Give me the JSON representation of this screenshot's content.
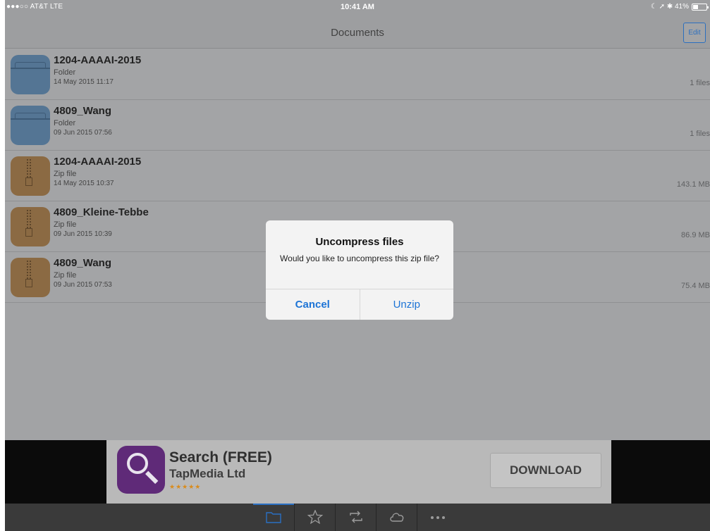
{
  "status_bar": {
    "carrier": "●●●○○ AT&T  LTE",
    "time": "10:41 AM",
    "indicators": "☾ ➚ ✱ 41%",
    "battery_percent": 41
  },
  "nav": {
    "title": "Documents",
    "edit_label": "Edit"
  },
  "files": [
    {
      "name": "1204-AAAAI-2015",
      "type": "Folder",
      "date": "14 May 2015 11:17",
      "size": "1 files",
      "icon": "folder-icon"
    },
    {
      "name": "4809_Wang",
      "type": "Folder",
      "date": "09 Jun 2015 07:56",
      "size": "1 files",
      "icon": "folder-icon"
    },
    {
      "name": "1204-AAAAI-2015",
      "type": "Zip file",
      "date": "14 May 2015 10:37",
      "size": "143.1 MB",
      "icon": "zip-icon"
    },
    {
      "name": "4809_Kleine-Tebbe",
      "type": "Zip file",
      "date": "09 Jun 2015 10:39",
      "size": "86.9 MB",
      "icon": "zip-icon"
    },
    {
      "name": "4809_Wang",
      "type": "Zip file",
      "date": "09 Jun 2015 07:53",
      "size": "75.4 MB",
      "icon": "zip-icon"
    }
  ],
  "dialog": {
    "title": "Uncompress files",
    "message": "Would you like to uncompress this zip file?",
    "cancel_label": "Cancel",
    "confirm_label": "Unzip"
  },
  "ad": {
    "title": "Search (FREE)",
    "publisher": "TapMedia Ltd",
    "stars": "★★★★★",
    "rating_stars": 5,
    "download_label": "DOWNLOAD",
    "icon": "magnifier-icon"
  },
  "tab_bar": {
    "items": [
      "folder-icon",
      "star-icon",
      "transfer-icon",
      "cloud-icon",
      "more-icon"
    ],
    "active_index": 0
  },
  "colors": {
    "accent": "#2a6fc2",
    "folder": "#547594",
    "zip": "#8b6a43",
    "ad_icon": "#5f2a78"
  }
}
